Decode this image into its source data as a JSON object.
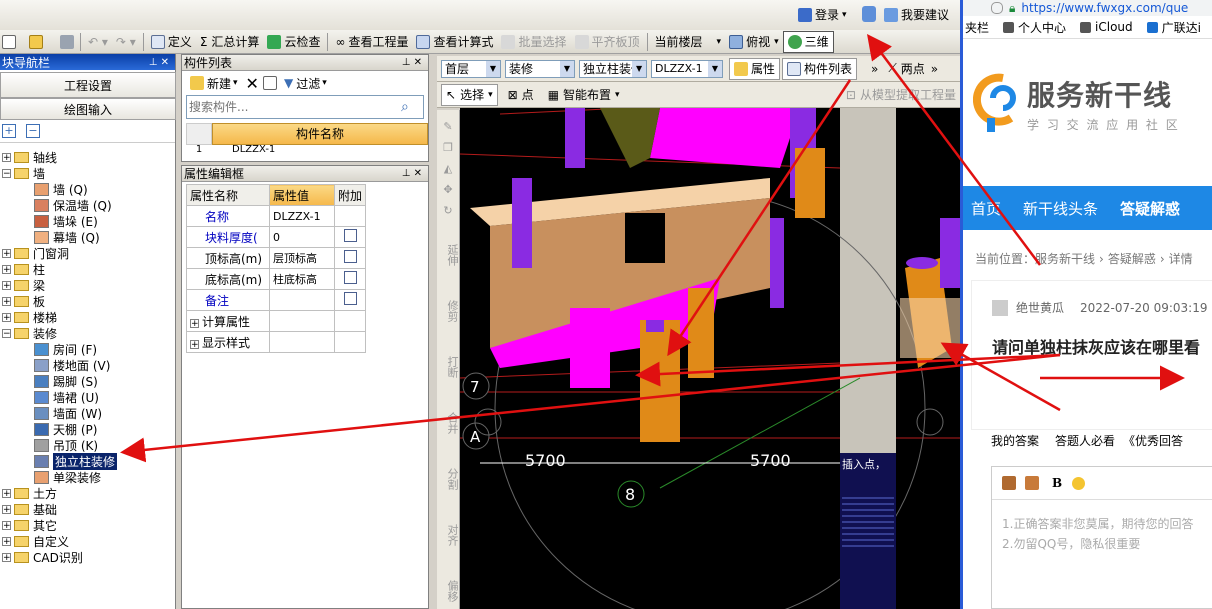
{
  "topbar": {
    "login": "登录",
    "feedback": "我要建议"
  },
  "toolbar": {
    "define": "定义",
    "sum_calc": "汇总计算",
    "cloud_check": "云检查",
    "view_quantity": "查看工程量",
    "view_formula": "查看计算式",
    "batch_select": "批量选择",
    "flush_board": "平齐板顶",
    "current_floor": "当前楼层",
    "top_view": "俯视",
    "three_d": "三维"
  },
  "nav": {
    "title": "块导航栏",
    "project_settings": "工程设置",
    "drawing_input": "绘图输入",
    "tree": [
      {
        "label": "轴线",
        "type": "folder",
        "open": false
      },
      {
        "label": "墙",
        "type": "folder",
        "open": true
      },
      {
        "label": "墙 (Q)",
        "type": "leaf"
      },
      {
        "label": "保温墙 (Q)",
        "type": "leaf"
      },
      {
        "label": "墙垛 (E)",
        "type": "leaf"
      },
      {
        "label": "幕墙 (Q)",
        "type": "leaf"
      },
      {
        "label": "门窗洞",
        "type": "folder",
        "open": false
      },
      {
        "label": "柱",
        "type": "folder",
        "open": false
      },
      {
        "label": "梁",
        "type": "folder",
        "open": false
      },
      {
        "label": "板",
        "type": "folder",
        "open": false
      },
      {
        "label": "楼梯",
        "type": "folder",
        "open": false
      },
      {
        "label": "装修",
        "type": "folder",
        "open": true
      },
      {
        "label": "房间 (F)",
        "type": "leaf"
      },
      {
        "label": "楼地面 (V)",
        "type": "leaf"
      },
      {
        "label": "踢脚 (S)",
        "type": "leaf"
      },
      {
        "label": "墙裙 (U)",
        "type": "leaf"
      },
      {
        "label": "墙面 (W)",
        "type": "leaf"
      },
      {
        "label": "天棚 (P)",
        "type": "leaf"
      },
      {
        "label": "吊顶 (K)",
        "type": "leaf"
      },
      {
        "label": "独立柱装修",
        "type": "leaf",
        "selected": true
      },
      {
        "label": "单梁装修",
        "type": "leaf"
      },
      {
        "label": "土方",
        "type": "folder",
        "open": false
      },
      {
        "label": "基础",
        "type": "folder",
        "open": false
      },
      {
        "label": "其它",
        "type": "folder",
        "open": false
      },
      {
        "label": "自定义",
        "type": "folder",
        "open": false
      },
      {
        "label": "CAD识别",
        "type": "folder",
        "open": false
      }
    ]
  },
  "component_list": {
    "title": "构件列表",
    "new_label": "新建",
    "filter_label": "过滤",
    "search_placeholder": "搜索构件...",
    "column_header": "构件名称",
    "row_index": "1",
    "row_partial": "DLZZX-1"
  },
  "property_editor": {
    "title": "属性编辑框",
    "headers": [
      "属性名称",
      "属性值",
      "附加"
    ],
    "rows": [
      {
        "name": "名称",
        "value": "DLZZX-1",
        "has_check": false,
        "blue": true
      },
      {
        "name": "块料厚度(",
        "value": "0",
        "has_check": true,
        "blue": true
      },
      {
        "name": "顶标高(m)",
        "value": "层顶标高",
        "has_check": true,
        "blue": false
      },
      {
        "name": "底标高(m)",
        "value": "柱底标高",
        "has_check": true,
        "blue": false
      },
      {
        "name": "备注",
        "value": "",
        "has_check": true,
        "blue": true
      }
    ],
    "groups": [
      "计算属性",
      "显示样式"
    ]
  },
  "canvas_toolbar": {
    "floor": "首层",
    "category": "装修",
    "type": "独立柱装修",
    "component": "DLZZX-1",
    "property_btn": "属性",
    "component_list_btn": "构件列表",
    "two_point": "两点",
    "select": "选择",
    "point": "点",
    "smart_layout": "智能布置",
    "extract_quantity": "从模型提取工程量",
    "insert_point": "插入点，"
  },
  "canvas": {
    "dim_left": "5700",
    "dim_right": "5700",
    "axis_8": "8",
    "axis_7": "7",
    "axis_a": "A"
  },
  "vertical_tools": [
    "延伸",
    "修剪",
    "打断",
    "合并",
    "分割",
    "对齐",
    "偏移"
  ],
  "browser": {
    "url": "https://www.fwxgx.com/que",
    "bookmarks": [
      "夹栏",
      "个人中心",
      "iCloud",
      "广联达i"
    ],
    "logo_title": "服务新干线",
    "logo_sub": "学 习 交 流 应 用 社 区",
    "nav": [
      "首页",
      "新干线头条",
      "答疑解惑"
    ],
    "breadcrumb": [
      "当前位置：",
      "服务新干线",
      "答疑解惑",
      "详情"
    ],
    "author": "绝世黄瓜",
    "time": "2022-07-20 09:03:19",
    "question": "请问单独柱抹灰应该在哪里看",
    "tabs": [
      "我的答案",
      "答题人必看",
      "《优秀回答"
    ],
    "editor_placeholder_1": "1.正确答案非您莫属，期待您的回答",
    "editor_placeholder_2": "2.勿留QQ号，隐私很重要",
    "bold": "B"
  }
}
